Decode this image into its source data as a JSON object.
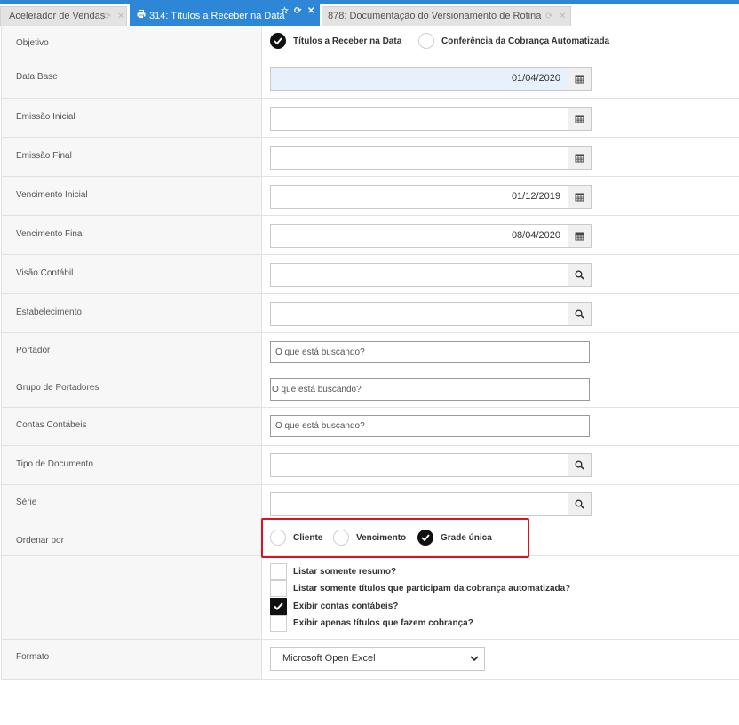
{
  "tabs": [
    {
      "label": "Acelerador de Vendas"
    },
    {
      "label": "314: Títulos a Receber na Data"
    },
    {
      "label": "878: Documentação do Versionamento de Rotina"
    }
  ],
  "form": {
    "objetivo": {
      "label": "Objetivo",
      "options": [
        "Títulos a Receber na Data",
        "Conferência da Cobrança Automatizada"
      ],
      "selected": 0
    },
    "data_base": {
      "label": "Data Base",
      "value": "01/04/2020"
    },
    "emissao_inicial": {
      "label": "Emissão Inicial",
      "value": ""
    },
    "emissao_final": {
      "label": "Emissão Final",
      "value": ""
    },
    "vencimento_inicial": {
      "label": "Vencimento Inicial",
      "value": "01/12/2019"
    },
    "vencimento_final": {
      "label": "Vencimento Final",
      "value": "08/04/2020"
    },
    "visao_contabil": {
      "label": "Visão Contábil",
      "value": ""
    },
    "estabelecimento": {
      "label": "Estabelecimento",
      "value": ""
    },
    "portador": {
      "label": "Portador",
      "placeholder": "O que está buscando?"
    },
    "grupo_portadores": {
      "label": "Grupo de Portadores",
      "placeholder": "O que está buscando?"
    },
    "contas_contabeis": {
      "label": "Contas Contábeis",
      "placeholder": "O que está buscando?"
    },
    "tipo_documento": {
      "label": "Tipo de Documento",
      "value": ""
    },
    "serie": {
      "label": "Série",
      "value": ""
    },
    "ordenar_por": {
      "label": "Ordenar por",
      "options": [
        "Cliente",
        "Vencimento",
        "Grade única"
      ],
      "selected": 2
    },
    "checkboxes": [
      {
        "label": "Listar somente resumo?",
        "checked": false
      },
      {
        "label": "Listar somente títulos que participam da cobrança automatizada?",
        "checked": false
      },
      {
        "label": "Exibir contas contábeis?",
        "checked": true
      },
      {
        "label": "Exibir apenas títulos que fazem cobrança?",
        "checked": false
      }
    ],
    "formato": {
      "label": "Formato",
      "value": "Microsoft Open Excel"
    }
  },
  "icons": {
    "calendar": "calendar-icon",
    "search": "search-icon",
    "chevron": "chevron-down-icon",
    "print": "print-icon"
  },
  "colors": {
    "accent": "#2e86d6",
    "highlight_border": "#e3101a",
    "checked": "#111111"
  }
}
